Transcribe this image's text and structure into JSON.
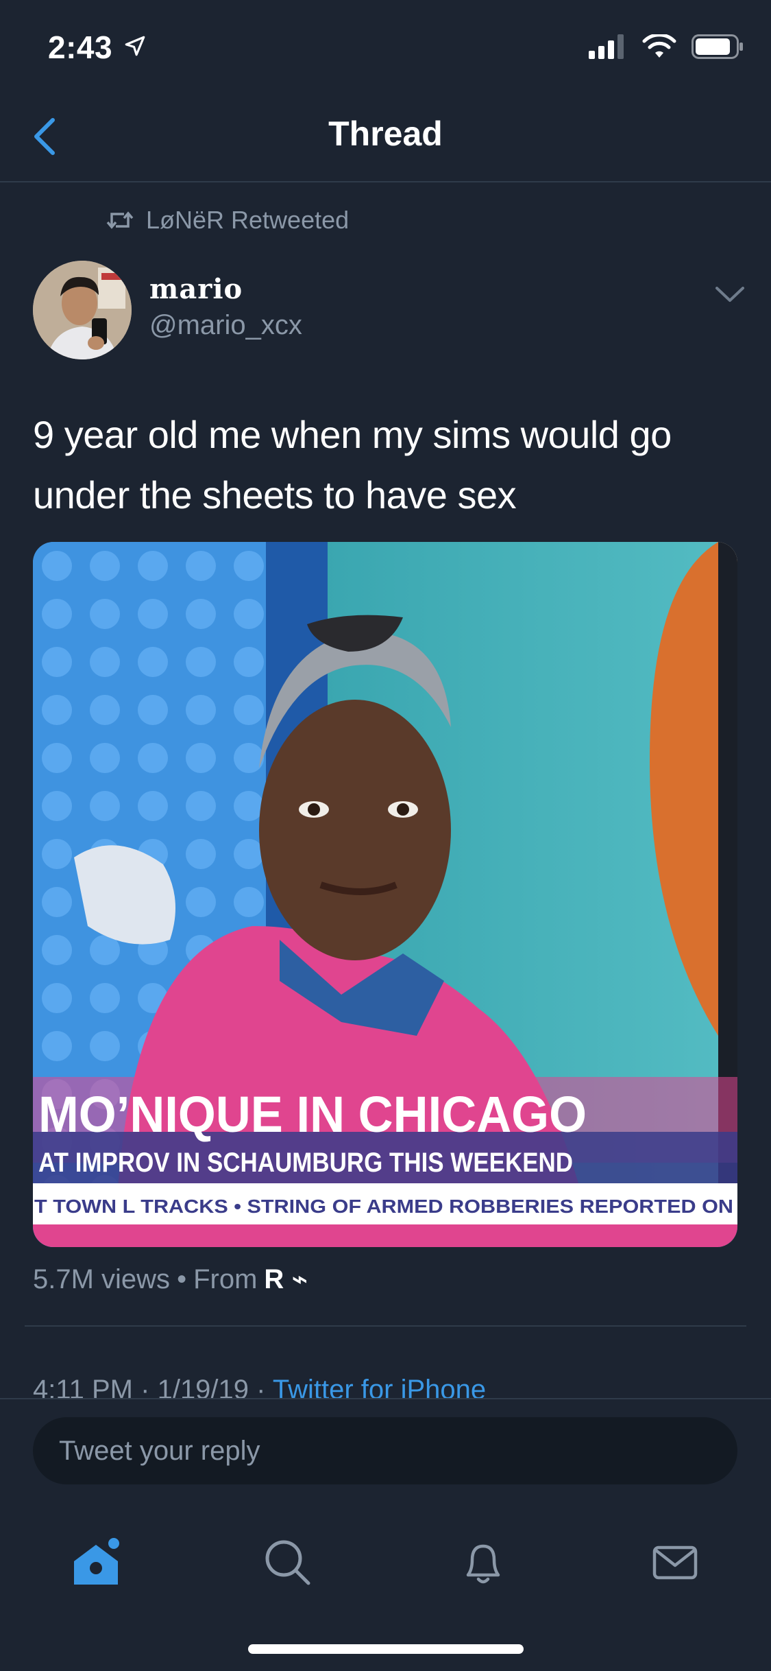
{
  "status_bar": {
    "time": "2:43"
  },
  "nav": {
    "title": "Thread"
  },
  "retweet": {
    "label": "LøNëR Retweeted"
  },
  "author": {
    "display_name": "mario",
    "handle": "@mario_xcx"
  },
  "tweet": {
    "text": "9 year old me when my sims would go under the sheets to have sex"
  },
  "media": {
    "headline": "MO’NIQUE IN CHICAGO",
    "subheadline": "AT IMPROV IN SCHAUMBURG THIS WEEKEND",
    "ticker": "T TOWN L TRACKS • STRING OF ARMED ROBBERIES REPORTED ON"
  },
  "stats": {
    "views": "5.7M views",
    "separator": "•",
    "from_label": "From",
    "source": "R ⌁"
  },
  "meta": {
    "time": "4:11 PM",
    "dot1": "·",
    "date": "1/19/19",
    "dot2": "·",
    "client": "Twitter for iPhone"
  },
  "reply": {
    "placeholder": "Tweet your reply"
  },
  "colors": {
    "background": "#1c2431",
    "accent": "#3a98e6",
    "secondary_text": "#8b98a8"
  }
}
